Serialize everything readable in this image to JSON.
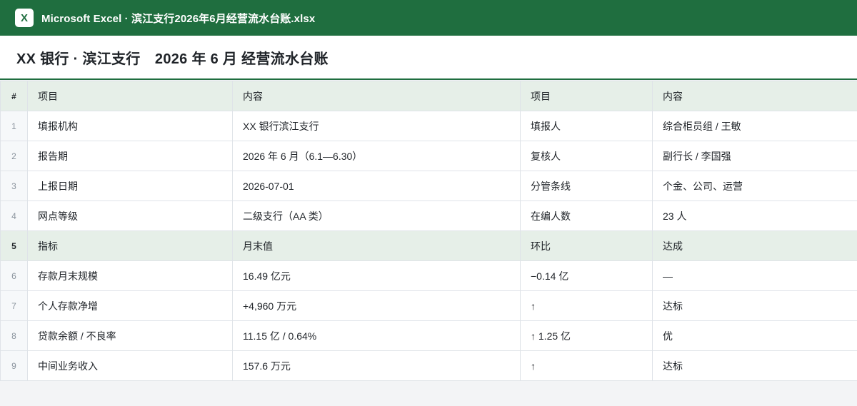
{
  "titlebar": {
    "logo_letter": "X",
    "title": "Microsoft Excel · 滨江支行2026年6月经营流水台账.xlsx"
  },
  "sheet": {
    "title": "XX 银行 · 滨江支行　2026 年 6 月 经营流水台账"
  },
  "header_row": {
    "num": "#",
    "col1": "项目",
    "col2": "内容",
    "col3": "项目",
    "col4": "内容"
  },
  "info_rows": [
    {
      "num": "1",
      "c1": "填报机构",
      "c2": "XX 银行滨江支行",
      "c3": "填报人",
      "c4": "综合柜员组 / 王敏"
    },
    {
      "num": "2",
      "c1": "报告期",
      "c2": "2026 年 6 月（6.1—6.30）",
      "c3": "复核人",
      "c4": "副行长 / 李国强"
    },
    {
      "num": "3",
      "c1": "上报日期",
      "c2": "2026-07-01",
      "c3": "分管条线",
      "c4": "个金、公司、运营"
    },
    {
      "num": "4",
      "c1": "网点等级",
      "c2": "二级支行（AA 类）",
      "c3": "在编人数",
      "c4": "23 人"
    }
  ],
  "metric_header": {
    "num": "5",
    "col1": "指标",
    "col2": "月末值",
    "col3": "环比",
    "col4": "达成"
  },
  "metric_rows": [
    {
      "num": "6",
      "c1": "存款月末规模",
      "c2": "16.49 亿元",
      "c3": "−0.14 亿",
      "c4": "—"
    },
    {
      "num": "7",
      "c1": "个人存款净增",
      "c2": "+4,960 万元",
      "c3": "↑",
      "c4": "达标"
    },
    {
      "num": "8",
      "c1": "贷款余额 / 不良率",
      "c2": "11.15 亿 / 0.64%",
      "c3": "↑ 1.25 亿",
      "c4": "优"
    },
    {
      "num": "9",
      "c1": "中间业务收入",
      "c2": "157.6 万元",
      "c3": "↑",
      "c4": "达标"
    }
  ],
  "colors": {
    "brand": "#1f6e3f",
    "header_fill": "#e6efe8"
  }
}
